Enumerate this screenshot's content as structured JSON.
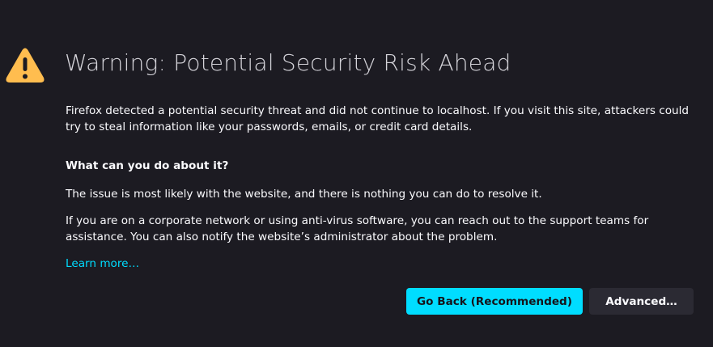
{
  "icons": {
    "warning": "warning-triangle-icon"
  },
  "colors": {
    "background": "#1c1b22",
    "accent": "#00ddff",
    "warning": "#ffbd4f",
    "secondary_button": "#2b2a33"
  },
  "title": "Warning: Potential Security Risk Ahead",
  "intro": "Firefox detected a potential security threat and did not continue to localhost. If you visit this site, attackers could try to steal information like your passwords, emails, or credit card details.",
  "what_heading": "What can you do about it?",
  "issue_text": "The issue is most likely with the website, and there is nothing you can do to resolve it.",
  "corporate_text": "If you are on a corporate network or using anti-virus software, you can reach out to the support teams for assistance. You can also notify the website’s administrator about the problem.",
  "learn_more": "Learn more…",
  "buttons": {
    "go_back": "Go Back (Recommended)",
    "advanced": "Advanced…"
  }
}
